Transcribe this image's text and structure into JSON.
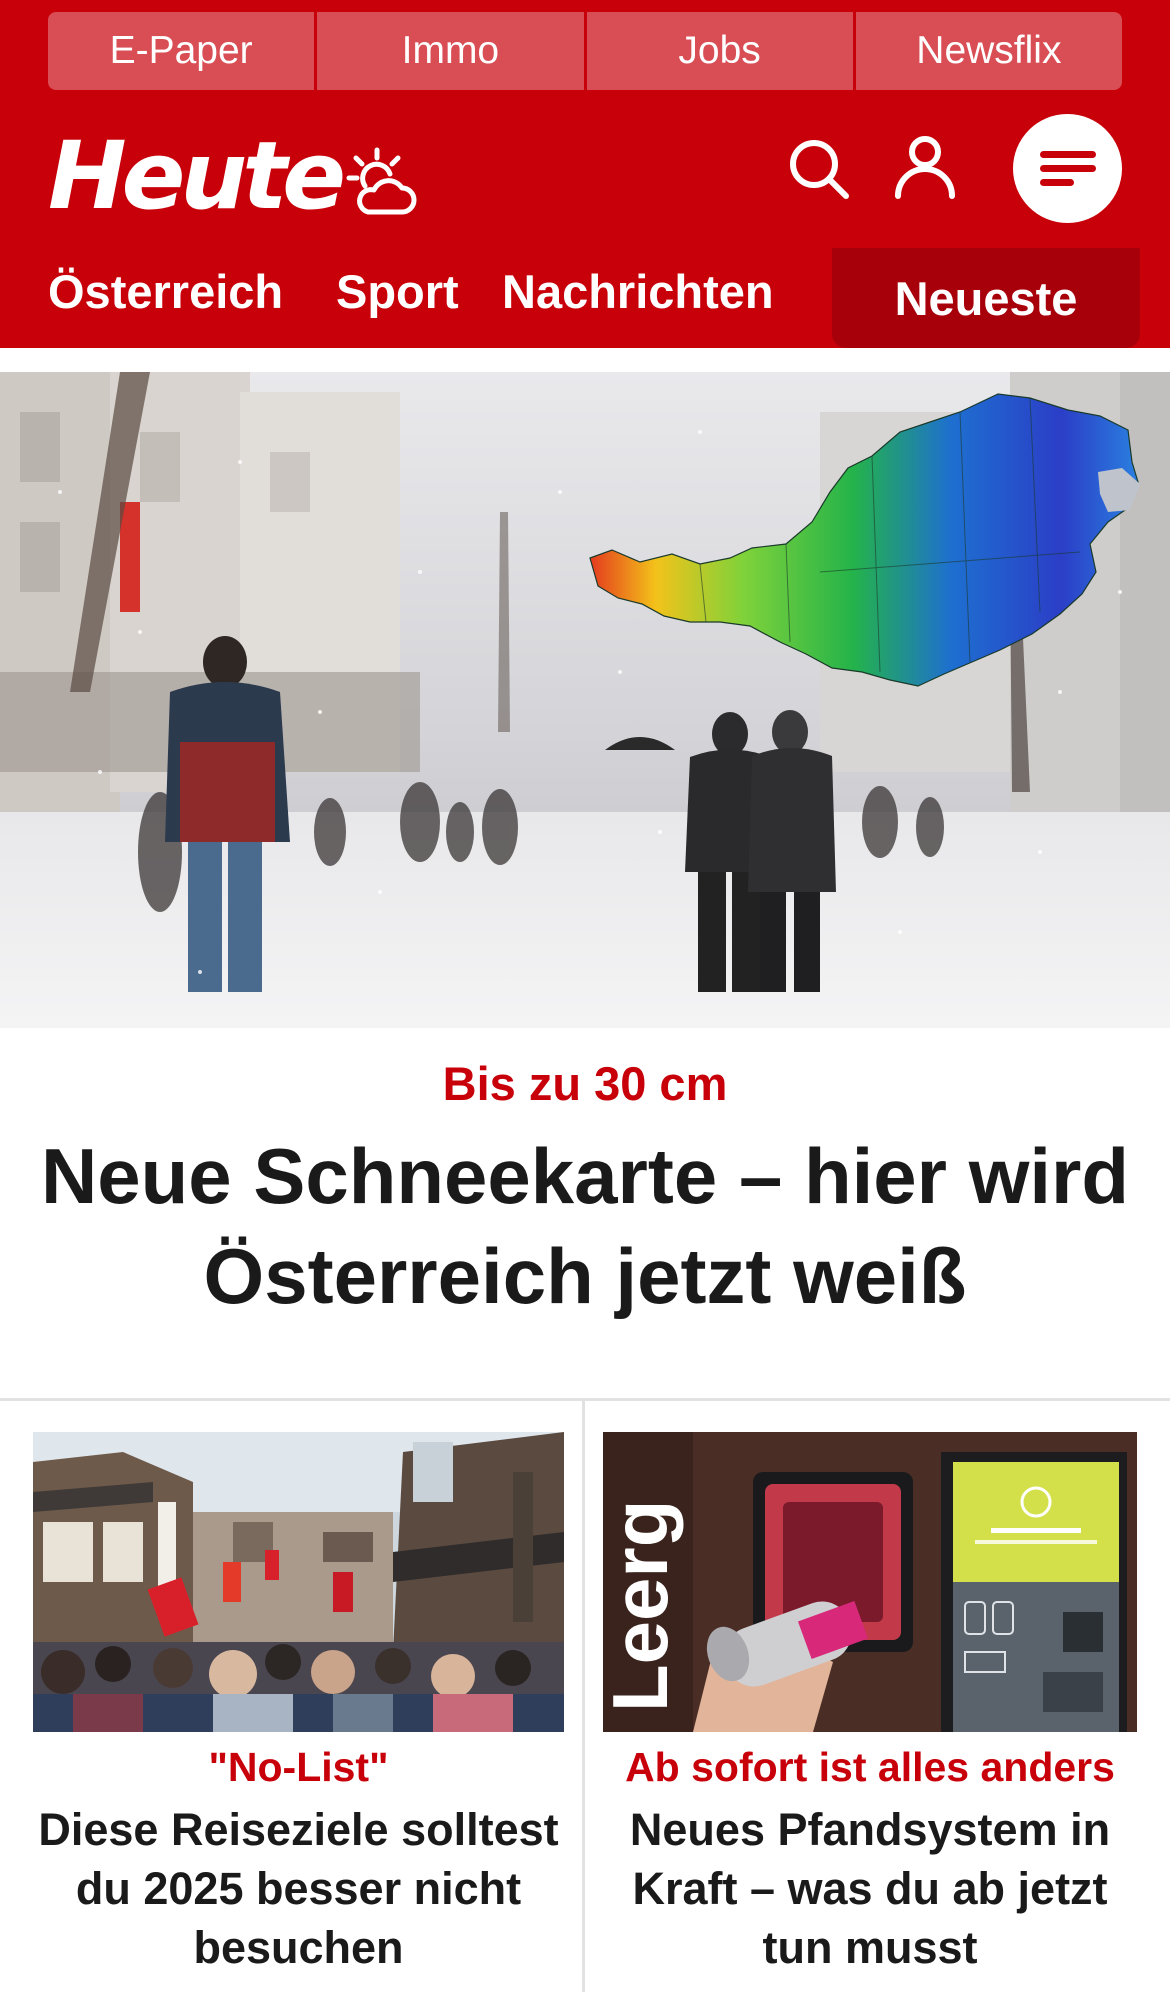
{
  "topnav": {
    "items": [
      "E-Paper",
      "Immo",
      "Jobs",
      "Newsflix"
    ]
  },
  "header": {
    "logo_text": "Heute",
    "icons": [
      "weather-sun-cloud-icon",
      "search-icon",
      "user-icon",
      "menu-icon"
    ]
  },
  "mainnav": {
    "items": [
      "Österreich",
      "Sport",
      "Nachrichten"
    ],
    "active": "Neueste"
  },
  "hero": {
    "image": "snowy-street-with-austria-snow-map",
    "kicker": "Bis zu 30 cm",
    "title": "Neue Schneekarte – hier wird Österreich jetzt weiß"
  },
  "teasers": [
    {
      "image": "crowded-street-japan",
      "kicker": "\"No-List\"",
      "title": "Diese Reiseziele solltest du 2025 besser nicht besuchen"
    },
    {
      "image": "can-deposit-machine",
      "kicker": "Ab sofort ist alles anders",
      "title": "Neues Pfandsystem in Kraft – was du ab jetzt tun musst"
    }
  ],
  "colors": {
    "brand_red": "#c8000a",
    "topnav_bg": "#d94e55",
    "active_tab": "#a8000a"
  }
}
